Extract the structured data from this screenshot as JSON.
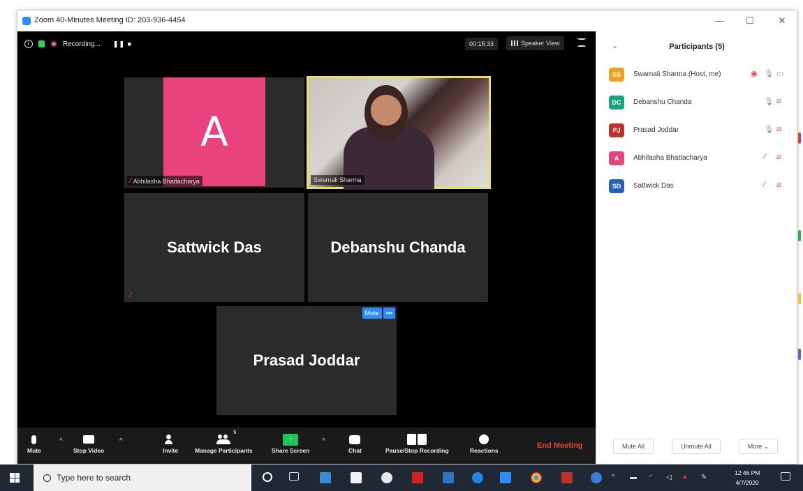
{
  "window": {
    "title": "Zoom 40-Minutes Meeting ID: 203-936-4454",
    "minimize": "—",
    "maximize": "☐",
    "close": "✕"
  },
  "topbar": {
    "recording_label": "Recording...",
    "recording_controls": "❚❚  ■",
    "timer": "00:15:33",
    "view_label": "Speaker View"
  },
  "tiles": {
    "abhilasha": {
      "initial": "A",
      "name": "Abhilasha Bhattacharya",
      "avatar_color": "#e8437d"
    },
    "swarnali": {
      "name": "Swarnali Sharma"
    },
    "sattwick": {
      "name": "Sattwick Das"
    },
    "debanshu": {
      "name": "Debanshu Chanda"
    },
    "prasad": {
      "name": "Prasad Joddar",
      "menu_mute": "Mute",
      "menu_more": "•••"
    }
  },
  "toolbar": {
    "mute": "Mute",
    "stop_video": "Stop Video",
    "invite": "Invite",
    "manage_participants": "Manage Participants",
    "participant_count": "5",
    "share_screen": "Share Screen",
    "chat": "Chat",
    "pause_stop_recording": "Pause/Stop Recording",
    "reactions": "Reactions",
    "end_meeting": "End Meeting",
    "caret": "^"
  },
  "panel": {
    "title": "Participants (5)",
    "collapse": "⌄",
    "participants": [
      {
        "initials": "SS",
        "name": "Swarnali Sharma (Host, me)",
        "color": "#f0a21c"
      },
      {
        "initials": "DC",
        "name": "Debanshu Chanda",
        "color": "#1ba37a"
      },
      {
        "initials": "PJ",
        "name": "Prasad Joddar",
        "color": "#c0312b"
      },
      {
        "initials": "A",
        "name": "Abhilasha Bhattacharya",
        "color": "#e8437d"
      },
      {
        "initials": "SD",
        "name": "Sattwick Das",
        "color": "#2563b8"
      }
    ],
    "mute_all": "Mute All",
    "unmute_all": "Unmute All",
    "more": "More ⌄"
  },
  "taskbar": {
    "search_placeholder": "Type here to search",
    "time": "12:46 PM",
    "date": "4/7/2020"
  }
}
